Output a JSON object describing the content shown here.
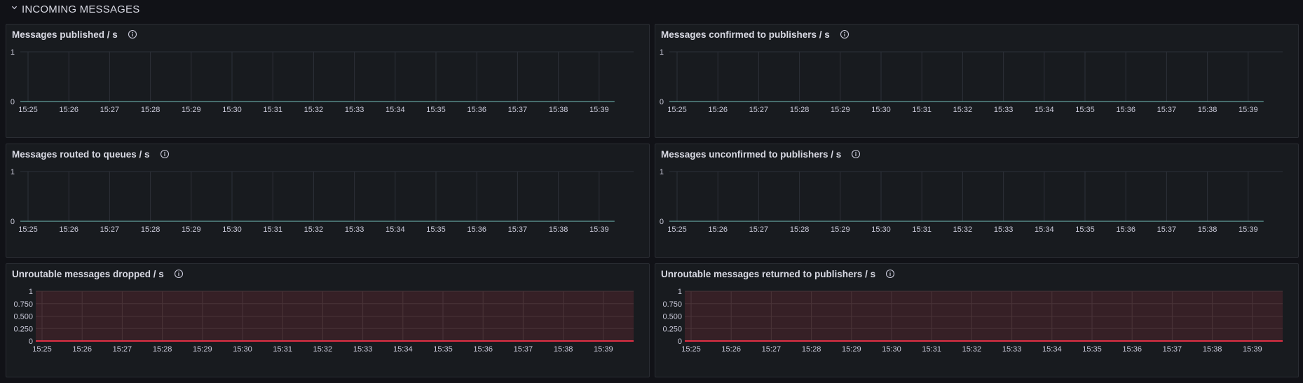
{
  "row": {
    "title": "INCOMING MESSAGES",
    "toggle_icon": "chevron-down-icon"
  },
  "colors": {
    "background": "#111217",
    "panel_bg": "#181b1f",
    "panel_border": "#2a2d33",
    "grid": "#2c3038",
    "series_line": "#73bfb8",
    "threshold_red": "#e02f44",
    "threshold_fill": "#3a2127",
    "text": "#ccccdc"
  },
  "panels": [
    {
      "title": "Messages published / s",
      "info_icon": "info-icon",
      "chart_data": {
        "type": "line",
        "x": [
          "15:25",
          "15:26",
          "15:27",
          "15:28",
          "15:29",
          "15:30",
          "15:31",
          "15:32",
          "15:33",
          "15:34",
          "15:35",
          "15:36",
          "15:37",
          "15:38",
          "15:39"
        ],
        "series": [
          {
            "values": [
              0,
              0,
              0,
              0,
              0,
              0,
              0,
              0,
              0,
              0,
              0,
              0,
              0,
              0,
              0
            ]
          }
        ],
        "yticks": [
          "0",
          "1"
        ],
        "ylim": [
          0,
          1
        ],
        "threshold_shading": false,
        "grid": true
      }
    },
    {
      "title": "Messages confirmed to publishers / s",
      "info_icon": "info-icon",
      "chart_data": {
        "type": "line",
        "x": [
          "15:25",
          "15:26",
          "15:27",
          "15:28",
          "15:29",
          "15:30",
          "15:31",
          "15:32",
          "15:33",
          "15:34",
          "15:35",
          "15:36",
          "15:37",
          "15:38",
          "15:39"
        ],
        "series": [
          {
            "values": [
              0,
              0,
              0,
              0,
              0,
              0,
              0,
              0,
              0,
              0,
              0,
              0,
              0,
              0,
              0
            ]
          }
        ],
        "yticks": [
          "0",
          "1"
        ],
        "ylim": [
          0,
          1
        ],
        "threshold_shading": false,
        "grid": true
      }
    },
    {
      "title": "Messages routed to queues / s",
      "info_icon": "info-icon",
      "chart_data": {
        "type": "line",
        "x": [
          "15:25",
          "15:26",
          "15:27",
          "15:28",
          "15:29",
          "15:30",
          "15:31",
          "15:32",
          "15:33",
          "15:34",
          "15:35",
          "15:36",
          "15:37",
          "15:38",
          "15:39"
        ],
        "series": [
          {
            "values": [
              0,
              0,
              0,
              0,
              0,
              0,
              0,
              0,
              0,
              0,
              0,
              0,
              0,
              0,
              0
            ]
          }
        ],
        "yticks": [
          "0",
          "1"
        ],
        "ylim": [
          0,
          1
        ],
        "threshold_shading": false,
        "grid": true
      }
    },
    {
      "title": "Messages unconfirmed to publishers / s",
      "info_icon": "info-icon",
      "chart_data": {
        "type": "line",
        "x": [
          "15:25",
          "15:26",
          "15:27",
          "15:28",
          "15:29",
          "15:30",
          "15:31",
          "15:32",
          "15:33",
          "15:34",
          "15:35",
          "15:36",
          "15:37",
          "15:38",
          "15:39"
        ],
        "series": [
          {
            "values": [
              0,
              0,
              0,
              0,
              0,
              0,
              0,
              0,
              0,
              0,
              0,
              0,
              0,
              0,
              0
            ]
          }
        ],
        "yticks": [
          "0",
          "1"
        ],
        "ylim": [
          0,
          1
        ],
        "threshold_shading": false,
        "grid": true
      }
    },
    {
      "title": "Unroutable messages dropped / s",
      "info_icon": "info-icon",
      "chart_data": {
        "type": "line",
        "x": [
          "15:25",
          "15:26",
          "15:27",
          "15:28",
          "15:29",
          "15:30",
          "15:31",
          "15:32",
          "15:33",
          "15:34",
          "15:35",
          "15:36",
          "15:37",
          "15:38",
          "15:39"
        ],
        "series": [
          {
            "values": [
              0,
              0,
              0,
              0,
              0,
              0,
              0,
              0,
              0,
              0,
              0,
              0,
              0,
              0,
              0
            ]
          }
        ],
        "yticks": [
          "0",
          "0.250",
          "0.500",
          "0.750",
          "1"
        ],
        "ylim": [
          0,
          1
        ],
        "threshold_shading": true,
        "grid": true
      }
    },
    {
      "title": "Unroutable messages returned to publishers / s",
      "info_icon": "info-icon",
      "chart_data": {
        "type": "line",
        "x": [
          "15:25",
          "15:26",
          "15:27",
          "15:28",
          "15:29",
          "15:30",
          "15:31",
          "15:32",
          "15:33",
          "15:34",
          "15:35",
          "15:36",
          "15:37",
          "15:38",
          "15:39"
        ],
        "series": [
          {
            "values": [
              0,
              0,
              0,
              0,
              0,
              0,
              0,
              0,
              0,
              0,
              0,
              0,
              0,
              0,
              0
            ]
          }
        ],
        "yticks": [
          "0",
          "0.250",
          "0.500",
          "0.750",
          "1"
        ],
        "ylim": [
          0,
          1
        ],
        "threshold_shading": true,
        "grid": true
      }
    }
  ]
}
